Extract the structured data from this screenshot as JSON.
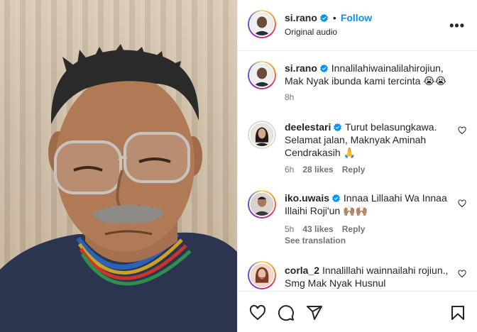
{
  "post": {
    "username": "si.rano",
    "follow_label": "Follow",
    "separator": "•",
    "audio": "Original audio",
    "more_label": "•••"
  },
  "caption": {
    "username": "si.rano",
    "text": "Innalilahiwainalilahirojiun, Mak Nyak ibunda kami tercinta 😭😭",
    "time": "8h"
  },
  "comments": [
    {
      "username": "deelestari",
      "text": "Turut belasungkawa. Selamat jalan, Maknyak Aminah Cendrakasih 🙏",
      "time": "6h",
      "likes": "28 likes",
      "reply": "Reply"
    },
    {
      "username": "iko.uwais",
      "text": "Innaa Lillaahi Wa Innaa Illaihi Roji'un 🙌🏽🙌🏽",
      "time": "5h",
      "likes": "43 likes",
      "reply": "Reply",
      "see_translation": "See translation"
    },
    {
      "username": "corla_2",
      "text": "Innalillahi wainnailahi rojiun., Smg Mak Nyak Husnul"
    }
  ],
  "icons": {
    "like": "heart-icon",
    "comment": "comment-icon",
    "share": "share-icon",
    "save": "bookmark-icon",
    "verified": "verified-badge-icon",
    "options": "more-options-icon"
  },
  "colors": {
    "link_blue": "#0095f6",
    "verified_blue": "#0095f6",
    "text": "#262626",
    "muted": "#737373"
  }
}
